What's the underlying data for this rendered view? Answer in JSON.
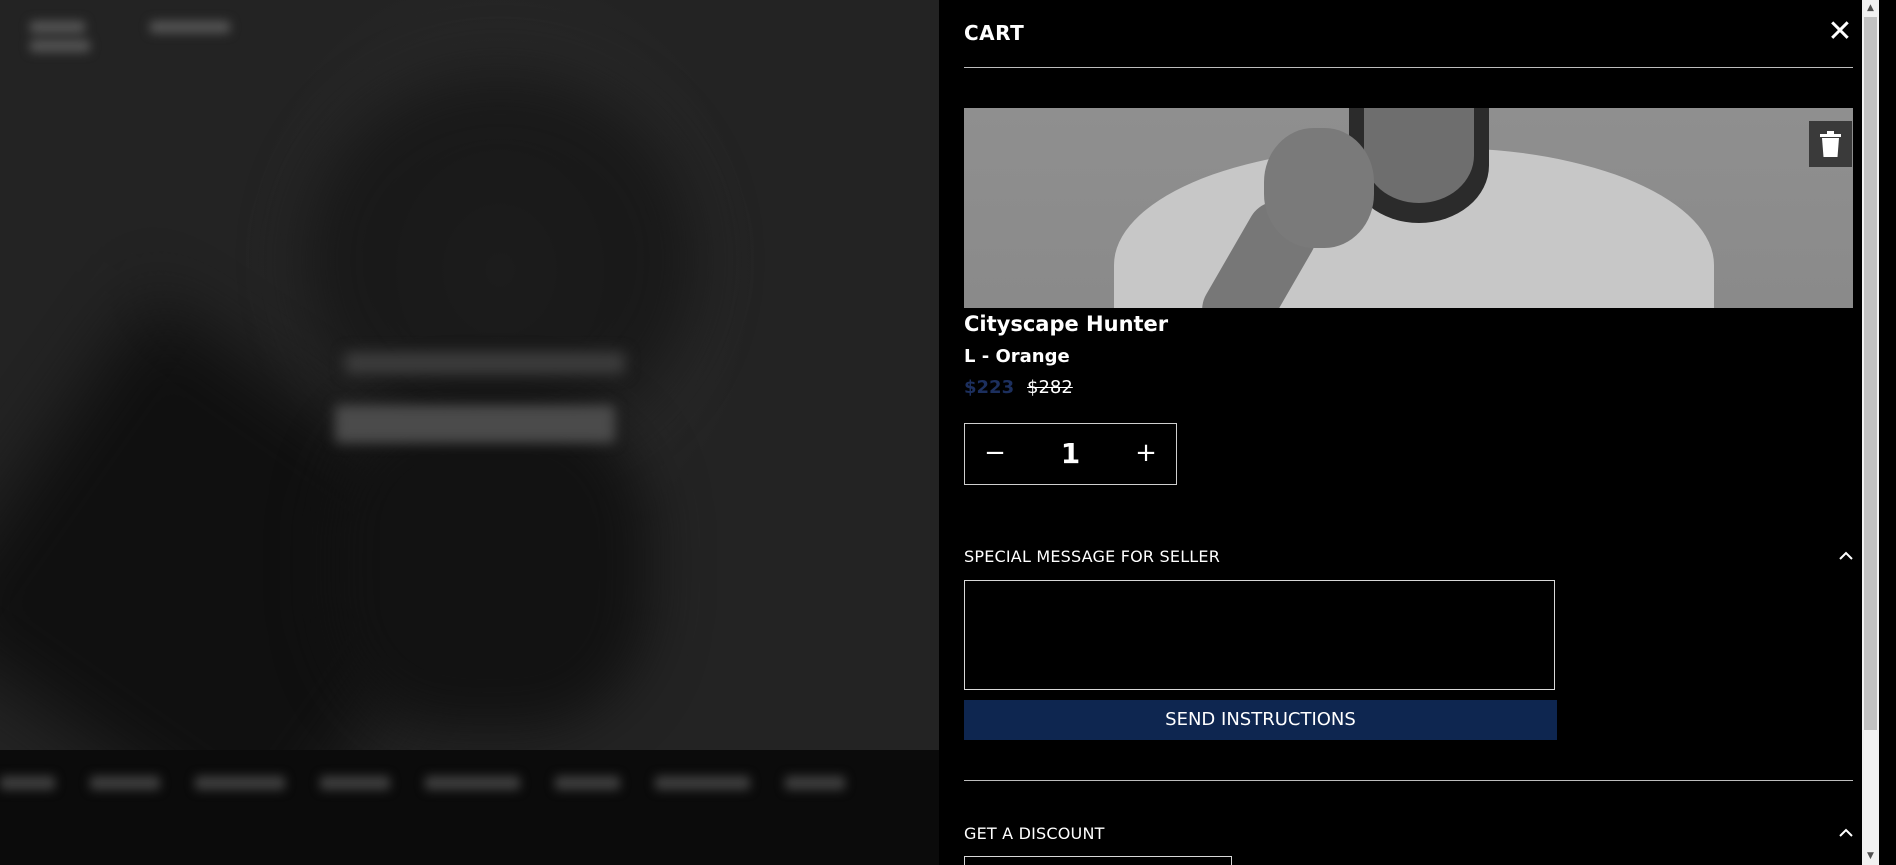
{
  "cart": {
    "title": "CART",
    "close_icon": "close-icon"
  },
  "item": {
    "name": "Cityscape Hunter",
    "variant": "L - Orange",
    "price_sale": "$223",
    "price_original": "$282",
    "quantity": "1",
    "decrement_label": "−",
    "increment_label": "+",
    "delete_icon": "trash-icon"
  },
  "special_message": {
    "title": "SPECIAL MESSAGE FOR SELLER",
    "textarea_value": "",
    "button_label": "SEND INSTRUCTIONS",
    "toggle_icon": "chevron-up-icon"
  },
  "discount": {
    "title": "GET A DISCOUNT",
    "toggle_icon": "chevron-up-icon"
  },
  "colors": {
    "accent": "#0e2650",
    "sale_price": "#1c2f5e",
    "background": "#000000"
  }
}
